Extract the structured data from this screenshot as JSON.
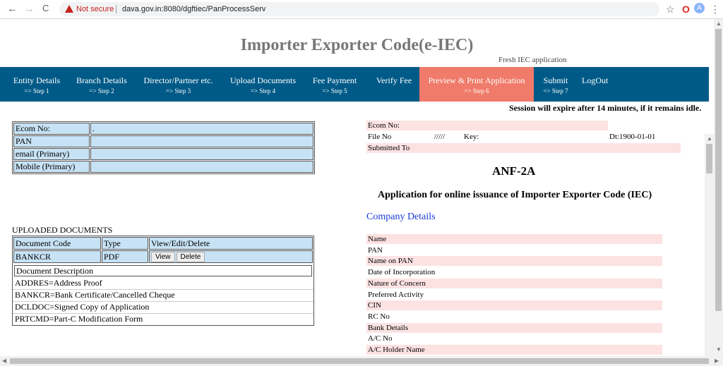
{
  "browser": {
    "back": "←",
    "forward": "→",
    "reload": "C",
    "security": "Not secure",
    "url": "dava.gov.in:8080/dgftiec/PanProcessServ",
    "avatar": "A"
  },
  "header": {
    "title": "Importer Exporter Code(e-IEC)",
    "subtitle": "Fresh IEC application"
  },
  "nav": [
    {
      "label": "Entity Details",
      "step": "=> Step 1"
    },
    {
      "label": "Branch Details",
      "step": "=> Step 2"
    },
    {
      "label": "Director/Partner etc.",
      "step": "=> Step 3"
    },
    {
      "label": "Upload Documents",
      "step": "=> Step 4"
    },
    {
      "label": "Fee Payment",
      "step": "=> Step 5"
    },
    {
      "label": "Verify Fee",
      "step": ""
    },
    {
      "label": "Preview & Print Application",
      "step": "=> Step 6"
    },
    {
      "label": "Submit",
      "step": "=> Step 7"
    },
    {
      "label": "LogOut",
      "step": ""
    }
  ],
  "session": "Session will expire after   14  minutes, if it remains idle.",
  "info_table": {
    "rows": [
      {
        "label": "Ecom No:",
        "value": "."
      },
      {
        "label": "PAN",
        "value": ""
      },
      {
        "label": "email (Primary)",
        "value": ""
      },
      {
        "label": "Mobile (Primary)",
        "value": ""
      }
    ]
  },
  "uploaded": {
    "heading": "UPLOADED DOCUMENTS",
    "headers": [
      "Document Code",
      "Type",
      "View/Edit/Delete"
    ],
    "row": {
      "code": "BANKCR",
      "type": "PDF",
      "view": "View",
      "delete": "Delete"
    },
    "desc_header": "Document Description",
    "descriptions": [
      "ADDRES=Address Proof",
      "BANKCR=Bank Certificate/Cancelled Cheque",
      "DCLDOC=Signed Copy of Application",
      "PRTCMD=Part-C Modification Form"
    ]
  },
  "right": {
    "ecom_label": "Ecom No:",
    "file_label": "File No",
    "file_value": "/////",
    "key_label": "Key:",
    "date": "Dt:1900-01-01",
    "submitted_label": "Submitted To",
    "anf": "ANF-2A",
    "app_title": "Application for online issuance of Importer Exporter Code (IEC)",
    "section": "Company Details",
    "fields": [
      "Name",
      "PAN",
      "Name on PAN",
      "Date of Incorporation",
      "Nature of Concern",
      "Preferred Activity",
      "CIN",
      "RC No",
      "Bank Details",
      "A/C No",
      "A/C Holder Name"
    ]
  }
}
